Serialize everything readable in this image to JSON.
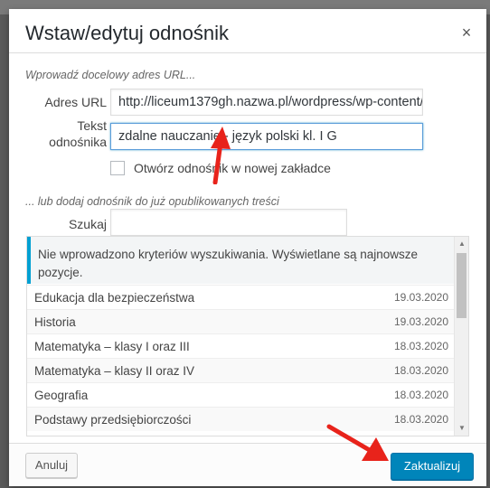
{
  "dialog": {
    "title": "Wstaw/edytuj odnośnik",
    "close_icon": "×"
  },
  "link_form": {
    "hint": "Wprowadź docelowy adres URL...",
    "url_label": "Adres URL",
    "url_value": "http://liceum1379gh.nazwa.pl/wordpress/wp-content/",
    "text_label_line1": "Tekst",
    "text_label_line2": "odnośnika",
    "text_value": "zdalne nauczanie - język polski kl. I G",
    "new_tab_label": "Otwórz odnośnik w nowej zakładce"
  },
  "search": {
    "hint": "... lub dodaj odnośnik do już opublikowanych treści",
    "label": "Szukaj",
    "value": ""
  },
  "results": {
    "notice": "Nie wprowadzono kryteriów wyszukiwania. Wyświetlane są najnowsze pozycje.",
    "items": [
      {
        "title": "Edukacja dla bezpieczeństwa",
        "date": "19.03.2020"
      },
      {
        "title": "Historia",
        "date": "19.03.2020"
      },
      {
        "title": "Matematyka – klasy I oraz III",
        "date": "18.03.2020"
      },
      {
        "title": "Matematyka – klasy II oraz IV",
        "date": "18.03.2020"
      },
      {
        "title": "Geografia",
        "date": "18.03.2020"
      },
      {
        "title": "Podstawy przedsiębiorczości",
        "date": "18.03.2020"
      }
    ]
  },
  "footer": {
    "cancel_label": "Anuluj",
    "update_label": "Zaktualizuj"
  },
  "colors": {
    "accent": "#0085ba",
    "annotation_arrow": "#e8231b"
  }
}
